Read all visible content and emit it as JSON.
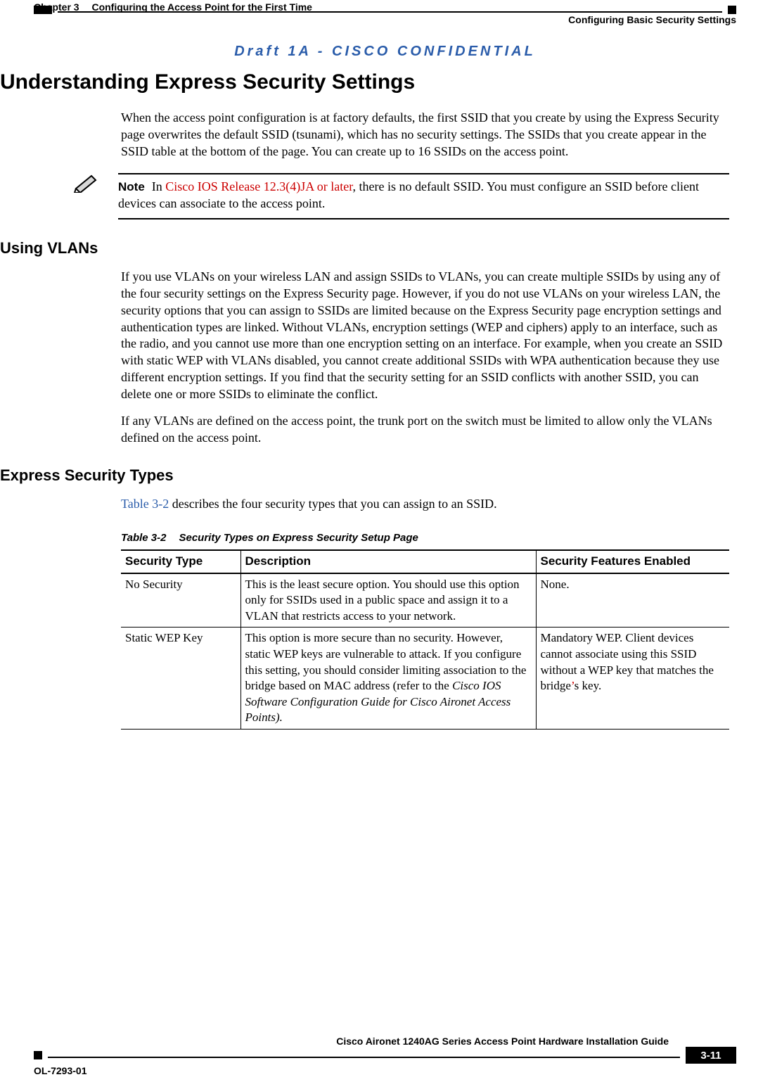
{
  "header": {
    "chapter_label": "Chapter 3",
    "chapter_title": "Configuring the Access Point for the First Time",
    "section_right": "Configuring Basic Security Settings",
    "draft_banner": "Draft 1A - CISCO CONFIDENTIAL"
  },
  "h1": "Understanding Express Security Settings",
  "intro_p": "When the access point configuration is at factory defaults, the first SSID that you create by using the Express Security page overwrites the default SSID (tsunami), which has no security settings. The SSIDs that you create appear in the SSID table at the bottom of the page. You can create up to 16 SSIDs on the access point.",
  "note": {
    "label": "Note",
    "prefix": "In ",
    "redtext": "Cisco IOS Release 12.3(4)JA or later",
    "suffix": ", there is no default SSID. You must configure an SSID before client devices can associate to the access point."
  },
  "h2_vlan": "Using VLANs",
  "vlan_p1": "If you use VLANs on your wireless LAN and assign SSIDs to VLANs, you can create multiple SSIDs by using any of the four security settings on the Express Security page. However, if you do not use VLANs on your wireless LAN, the security options that you can assign to SSIDs are limited because on the Express Security page encryption settings and authentication types are linked. Without VLANs, encryption settings (WEP and ciphers) apply to an interface, such as the radio, and you cannot use more than one encryption setting on an interface. For example, when you create an SSID with static WEP with VLANs disabled, you cannot create additional SSIDs with WPA authentication because they use different encryption settings. If you find that the security setting for an SSID conflicts with another SSID, you can delete one or more SSIDs to eliminate the conflict.",
  "vlan_p2": "If any VLANs are defined on the access point, the trunk port on the switch must be limited to allow only the VLANs defined on the access point.",
  "h2_types": "Express Security Types",
  "types_intro_link": "Table 3-2",
  "types_intro_rest": " describes the four security types that you can assign to an SSID.",
  "table": {
    "caption_num": "Table 3-2",
    "caption_text": "Security Types on Express Security Setup Page",
    "headers": {
      "col1": "Security Type",
      "col2": "Description",
      "col3": "Security Features Enabled"
    },
    "rows": [
      {
        "c1": "No Security",
        "c2": "This is the least secure option. You should use this option only for SSIDs used in a public space and assign it to a VLAN that restricts access to your network.",
        "c3": "None."
      },
      {
        "c1": "Static WEP Key",
        "c2_main": "This option is more secure than no security. However, static WEP keys are vulnerable to attack. If you configure this setting, you should consider limiting association to the bridge based on MAC address (refer to the ",
        "c2_ital": "Cisco IOS Software Configuration Guide for Cisco Aironet Access Points).",
        "c3_pre": "Mandatory WEP. Client devices cannot associate using this SSID without a WEP key that matches the bridge",
        "c3_apost": "’",
        "c3_post": "s key."
      }
    ]
  },
  "footer": {
    "guide": "Cisco Aironet 1240AG Series Access Point Hardware Installation Guide",
    "ol": "OL-7293-01",
    "pagenum": "3-11"
  }
}
